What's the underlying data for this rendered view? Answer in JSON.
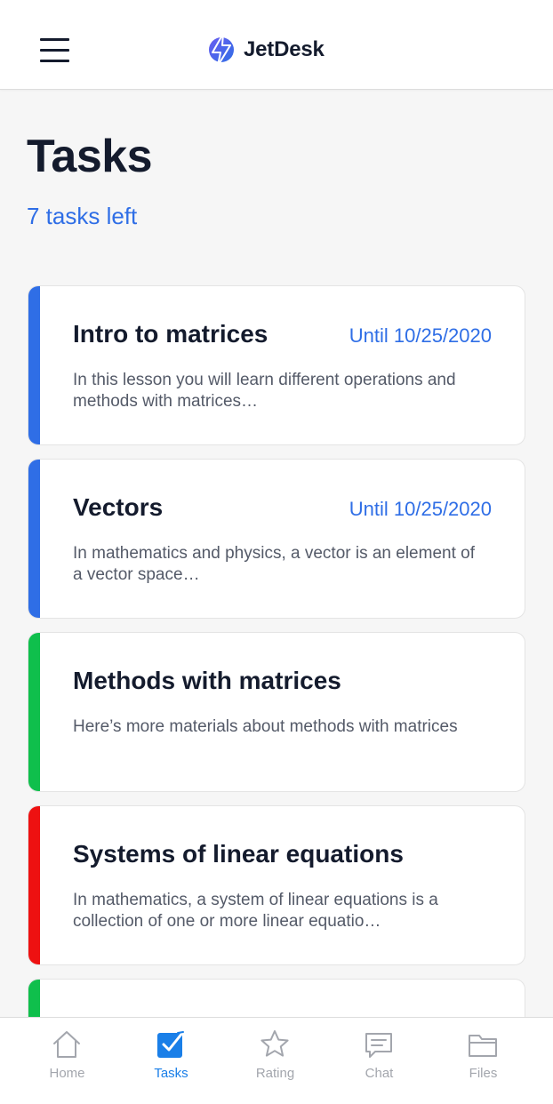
{
  "app": {
    "name": "JetDesk"
  },
  "page": {
    "title": "Tasks",
    "tasks_left": "7 tasks left"
  },
  "colors": {
    "accent": "#2f6ee6",
    "nav_active": "#1a7fe8",
    "stripe_blue": "#2f6ee6",
    "stripe_green": "#0fbf4c",
    "stripe_red": "#ee1111"
  },
  "tasks": [
    {
      "title": "Intro to matrices",
      "due": "Until 10/25/2020",
      "description": "In this lesson you will learn different operations and methods with matrices…",
      "stripe_color": "#2f6ee6"
    },
    {
      "title": "Vectors",
      "due": "Until 10/25/2020",
      "description": "In mathematics and physics, a vector is an element of a vector space…",
      "stripe_color": "#2f6ee6"
    },
    {
      "title": "Methods with matrices",
      "due": "",
      "description": "Here’s more materials about methods with matrices",
      "stripe_color": "#0fbf4c"
    },
    {
      "title": "Systems of linear equations",
      "due": "",
      "description": "In mathematics, a system of linear equations is a collection of one or more linear equatio…",
      "stripe_color": "#ee1111"
    },
    {
      "title": "",
      "due": "",
      "description": "",
      "stripe_color": "#0fbf4c"
    }
  ],
  "nav": {
    "items": [
      {
        "label": "Home",
        "icon": "home-icon",
        "active": false
      },
      {
        "label": "Tasks",
        "icon": "tasks-icon",
        "active": true
      },
      {
        "label": "Rating",
        "icon": "star-icon",
        "active": false
      },
      {
        "label": "Chat",
        "icon": "chat-icon",
        "active": false
      },
      {
        "label": "Files",
        "icon": "folder-icon",
        "active": false
      }
    ]
  }
}
